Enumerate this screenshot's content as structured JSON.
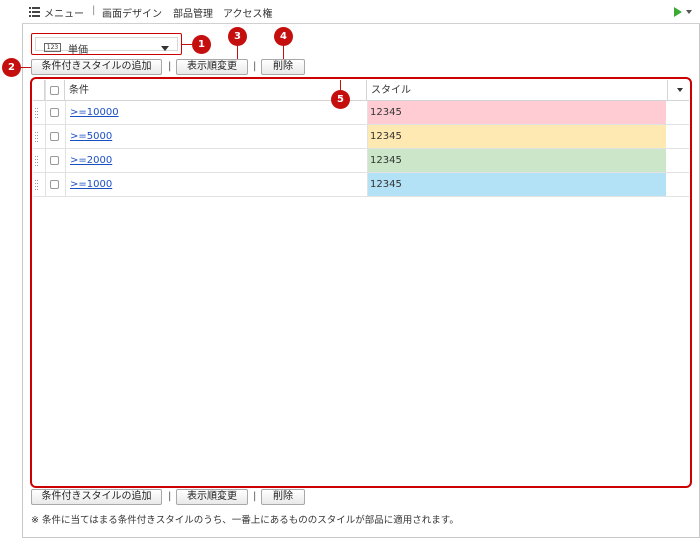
{
  "nav": {
    "items": [
      "メニュー",
      "画面デザイン",
      "部品管理",
      "アクセス権"
    ],
    "separator": "|",
    "icons": [
      "menu-list-icon",
      "play-icon",
      "chevron-down-icon"
    ]
  },
  "field_select": {
    "type_icon_text": "123",
    "value": "単価"
  },
  "toolbar": {
    "add_label": "条件付きスタイルの追加",
    "order_label": "表示順変更",
    "delete_label": "削除",
    "separator": "|"
  },
  "callouts": [
    "1",
    "2",
    "3",
    "4",
    "5"
  ],
  "grid": {
    "columns": [
      "条件",
      "スタイル"
    ],
    "rows": [
      {
        "condition": ">=10000",
        "sample": "12345",
        "color": "#ffccd4"
      },
      {
        "condition": ">=5000",
        "sample": "12345",
        "color": "#ffe9b3"
      },
      {
        "condition": ">=2000",
        "sample": "12345",
        "color": "#cbe6c8"
      },
      {
        "condition": ">=1000",
        "sample": "12345",
        "color": "#b3e1f6"
      }
    ]
  },
  "bottom_toolbar": {
    "add_label": "条件付きスタイルの追加",
    "order_label": "表示順変更",
    "delete_label": "削除",
    "separator": "|"
  },
  "note": "※ 条件に当てはまる条件付きスタイルのうち、一番上にあるもののスタイルが部品に適用されます。",
  "colors": {
    "accent_red": "#c50f0f",
    "link": "#1a4fc2",
    "play_green": "#3aaa35"
  }
}
